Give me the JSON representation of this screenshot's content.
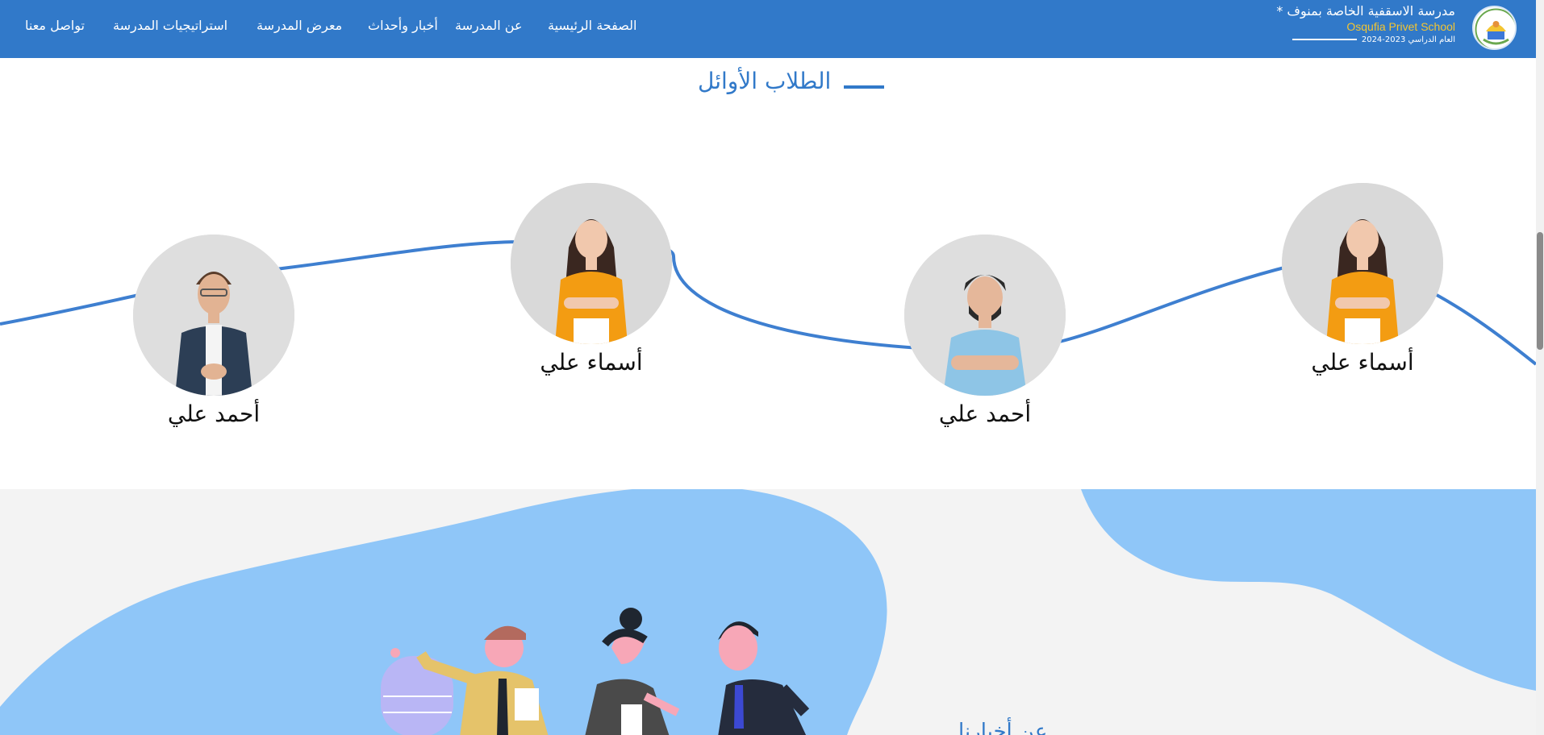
{
  "header": {
    "brand_ar": "مدرسة الاسقفية الخاصة بمنوف *",
    "brand_en": "Osqufia Privet School",
    "brand_year": "العام الدراسي 2023-2024",
    "nav": [
      "الصفحة الرئيسية",
      "عن المدرسة",
      "أخبار وأحداث",
      "معرض المدرسة",
      "استراتيجيات المدرسة",
      "تواصل معنا"
    ]
  },
  "top_students": {
    "title": "الطلاب الأوائل",
    "students": [
      {
        "name": "أسماء علي"
      },
      {
        "name": "أحمد علي"
      },
      {
        "name": "أسماء علي"
      },
      {
        "name": "أحمد علي"
      }
    ]
  },
  "lower": {
    "caption": "... عن أخبارنا"
  },
  "colors": {
    "primary": "#3179c9",
    "accent": "#f4c531",
    "blob": "#8fc6f8"
  }
}
